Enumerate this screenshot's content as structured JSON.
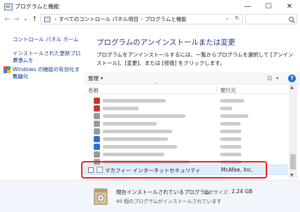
{
  "window": {
    "title": "プログラムと機能",
    "minimize": "—",
    "maximize": "☐",
    "close": "✕"
  },
  "address": {
    "segments": [
      "すべてのコントロール パネル項目",
      "プログラムと機能"
    ],
    "separator": "›"
  },
  "sidebar": {
    "home": "コントロール パネル ホーム",
    "updates_line1": "インストールされた更新プログラムを",
    "updates_line2": "表示",
    "features_line1": "Windows の機能の有効化または",
    "features_line2": "無効化"
  },
  "main": {
    "title": "プログラムのアンインストールまたは変更",
    "description": "プログラムをアンインストールするには、一覧からプログラムを選択して [アンインストール]、[変更]、または [修復] をクリックします。"
  },
  "toolbar": {
    "organize": "整理",
    "help": "?"
  },
  "columns": {
    "name": "名前",
    "publisher": "発行元"
  },
  "programs_blurred": [
    {
      "icon_color": "#c0392b",
      "name_width": 0.56,
      "pub_width": 0.36
    },
    {
      "icon_color": "#c0392b",
      "name_width": 0.32,
      "pub_width": 0.18
    },
    {
      "icon_color": "#9a9a9a",
      "name_width": 0.74,
      "pub_width": 0.42
    },
    {
      "icon_color": "#9a9a9a",
      "name_width": 0.48,
      "pub_width": 0.3
    },
    {
      "icon_color": "#9a9a9a",
      "name_width": 0.62,
      "pub_width": 0.32
    },
    {
      "icon_color": "#2f6fd1",
      "name_width": 0.58,
      "pub_width": 0.32
    },
    {
      "icon_color": "#2f6fd1",
      "name_width": 0.66,
      "pub_width": 0.32
    },
    {
      "icon_color": "#9a9a9a",
      "name_width": 0.55,
      "pub_width": 0.32
    },
    {
      "icon_color": "#9a9a9a",
      "name_width": 0.78,
      "pub_width": 0.32
    }
  ],
  "selected_program": {
    "name": "マカフィー インターネットセキュリティ",
    "publisher": "McAfee, Inc."
  },
  "status": {
    "title": "現在インストールされているプログラム",
    "size_label": "合計サイズ:",
    "size_value": "2.24 GB",
    "count": "40 個のプログラムがインストールされています"
  },
  "colors": {
    "highlight": "#ec1c24",
    "link": "#1c3f94",
    "heading": "#1e3287",
    "selection": "#dfeefd"
  }
}
